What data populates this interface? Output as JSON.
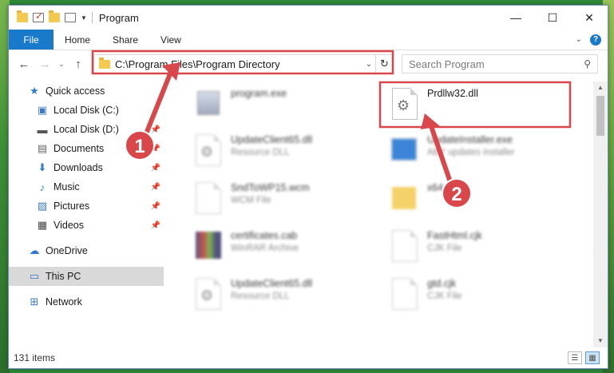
{
  "window": {
    "title": "Program",
    "controls": {
      "minimize": "—",
      "maximize": "☐",
      "close": "✕"
    }
  },
  "ribbon": {
    "tabs": [
      {
        "label": "File",
        "active": true
      },
      {
        "label": "Home"
      },
      {
        "label": "Share"
      },
      {
        "label": "View"
      }
    ]
  },
  "navigation": {
    "address_path": "C:\\Program Files\\Program Directory",
    "search_placeholder": "Search Program"
  },
  "sidebar": {
    "quick_access": "Quick access",
    "pinned": [
      {
        "label": "Local Disk (C:)",
        "icon": "local-disk-icon"
      },
      {
        "label": "Local Disk (D:)",
        "icon": "local-disk-icon"
      },
      {
        "label": "Documents",
        "icon": "documents-icon"
      },
      {
        "label": "Downloads",
        "icon": "downloads-icon"
      },
      {
        "label": "Music",
        "icon": "music-icon"
      },
      {
        "label": "Pictures",
        "icon": "pictures-icon"
      },
      {
        "label": "Videos",
        "icon": "videos-icon"
      }
    ],
    "onedrive": "OneDrive",
    "this_pc": "This PC",
    "network": "Network"
  },
  "files": [
    {
      "name": "program.exe",
      "type": "",
      "icon": "exe-icon",
      "highlighted": false
    },
    {
      "name": "Prdllw32.dll",
      "type": "",
      "icon": "dll-icon",
      "highlighted": true
    },
    {
      "name": "UpdateClient65.dll",
      "type": "Resource DLL",
      "icon": "dll-icon"
    },
    {
      "name": "UpdateInstaller.exe",
      "type": "ABY updates installer",
      "icon": "installer-icon"
    },
    {
      "name": "SndToWP15.wcm",
      "type": "WCM File",
      "icon": "file-icon"
    },
    {
      "name": "x64",
      "type": "",
      "icon": "folder-icon"
    },
    {
      "name": "certificates.cab",
      "type": "WinRAR Archive",
      "icon": "archive-icon"
    },
    {
      "name": "FastHtml.cjk",
      "type": "CJK File",
      "icon": "file-icon"
    },
    {
      "name": "UpdateClient65.dll",
      "type": "Resource DLL",
      "icon": "dll-icon"
    },
    {
      "name": "gtd.cjk",
      "type": "CJK File",
      "icon": "file-icon"
    }
  ],
  "status": {
    "item_count": "131 items"
  },
  "annotations": {
    "callout_1": "1",
    "callout_2": "2",
    "color": "#d9474b"
  }
}
